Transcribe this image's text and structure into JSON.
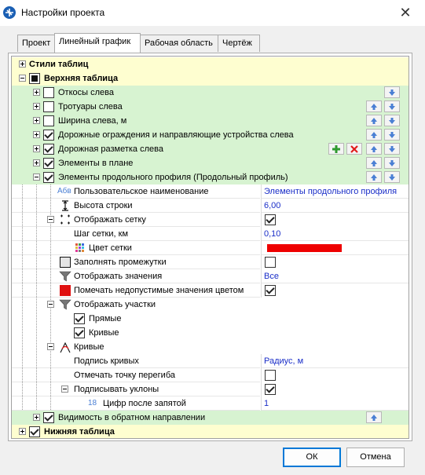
{
  "window": {
    "title": "Настройки проекта",
    "close_glyph": "✕"
  },
  "tabs": [
    {
      "label": "Проект",
      "active": false
    },
    {
      "label": "Линейный график",
      "active": true
    },
    {
      "label": "Рабочая область",
      "active": false
    },
    {
      "label": "Чертёж",
      "active": false
    }
  ],
  "tree": {
    "styles_tables": "Стили таблиц",
    "top_table": "Верхняя таблица",
    "items": [
      {
        "label": "Откосы слева",
        "checked": false
      },
      {
        "label": "Тротуары слева",
        "checked": false
      },
      {
        "label": "Ширина слева, м",
        "checked": false
      },
      {
        "label": "Дорожные ограждения и направляющие устройства слева",
        "checked": true
      },
      {
        "label": "Дорожная разметка слева",
        "checked": true
      },
      {
        "label": "Элементы в плане",
        "checked": true
      },
      {
        "label": "Элементы продольного профиля (Продольный профиль)",
        "checked": true
      }
    ],
    "props": {
      "user_name": {
        "label": "Пользовательское наименование",
        "value": "Элементы продольного профиля",
        "icon_text": "Абв"
      },
      "row_height": {
        "label": "Высота строки",
        "value": "6,00"
      },
      "show_grid": {
        "label": "Отображать сетку"
      },
      "grid_step": {
        "label": "Шаг сетки, км",
        "value": "0,10"
      },
      "grid_color": {
        "label": "Цвет сетки",
        "value_color": "#ee0000"
      },
      "fill_gaps": {
        "label": "Заполнять промежутки"
      },
      "show_values": {
        "label": "Отображать значения",
        "value": "Все"
      },
      "mark_invalid": {
        "label": "Помечать недопустимые значения цветом"
      },
      "show_sections": {
        "label": "Отображать участки"
      },
      "straight": {
        "label": "Прямые"
      },
      "curves_sub": {
        "label": "Кривые"
      },
      "curves": {
        "label": "Кривые"
      },
      "curve_label": {
        "label": "Подпись кривых",
        "value": "Радиус, м"
      },
      "inflection": {
        "label": "Отмечать точку перегиба"
      },
      "slopes": {
        "label": "Подписывать уклоны"
      },
      "decimals": {
        "label": "Цифр после запятой",
        "value": "1",
        "icon_text": "18"
      }
    },
    "reverse": "Видимость в обратном направлении",
    "bottom_table": "Нижняя таблица"
  },
  "buttons": {
    "ok": "ОК",
    "cancel": "Отмена"
  },
  "colors": {
    "accent": "#0078d7",
    "yellow_row": "#fefed0",
    "green_row": "#d7f3d1",
    "value_text": "#1a2ec8"
  }
}
